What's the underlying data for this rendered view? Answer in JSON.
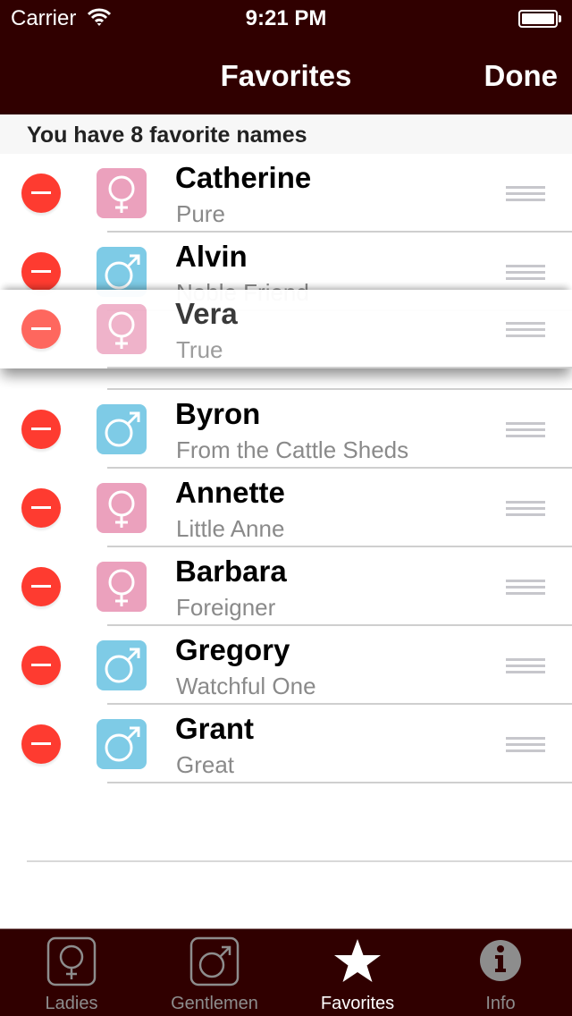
{
  "status_bar": {
    "carrier": "Carrier",
    "time": "9:21 PM",
    "battery_level": 1.0
  },
  "nav": {
    "title": "Favorites",
    "done_label": "Done"
  },
  "section_header": "You have 8 favorite names",
  "colors": {
    "bar_background": "#300000",
    "female_tile": "#eba1bd",
    "male_tile": "#7ecbe6",
    "delete_red": "#fe3b30"
  },
  "favorites": [
    {
      "name": "Catherine",
      "meaning": "Pure",
      "gender": "female",
      "icon": "female-symbol-icon"
    },
    {
      "name": "Alvin",
      "meaning": "Noble Friend",
      "gender": "male",
      "icon": "male-symbol-icon"
    },
    {
      "name": "Vera",
      "meaning": "True",
      "gender": "female",
      "icon": "female-symbol-icon",
      "dragging": true
    },
    {
      "name": "Byron",
      "meaning": "From the Cattle Sheds",
      "gender": "male",
      "icon": "male-symbol-icon"
    },
    {
      "name": "Annette",
      "meaning": "Little Anne",
      "gender": "female",
      "icon": "female-symbol-icon"
    },
    {
      "name": "Barbara",
      "meaning": "Foreigner",
      "gender": "female",
      "icon": "female-symbol-icon"
    },
    {
      "name": "Gregory",
      "meaning": "Watchful One",
      "gender": "male",
      "icon": "male-symbol-icon"
    },
    {
      "name": "Grant",
      "meaning": "Great",
      "gender": "male",
      "icon": "male-symbol-icon"
    }
  ],
  "tabs": [
    {
      "label": "Ladies",
      "icon": "female-symbol-icon",
      "active": false
    },
    {
      "label": "Gentlemen",
      "icon": "male-symbol-icon",
      "active": false
    },
    {
      "label": "Favorites",
      "icon": "star-icon",
      "active": true
    },
    {
      "label": "Info",
      "icon": "info-icon",
      "active": false
    }
  ]
}
